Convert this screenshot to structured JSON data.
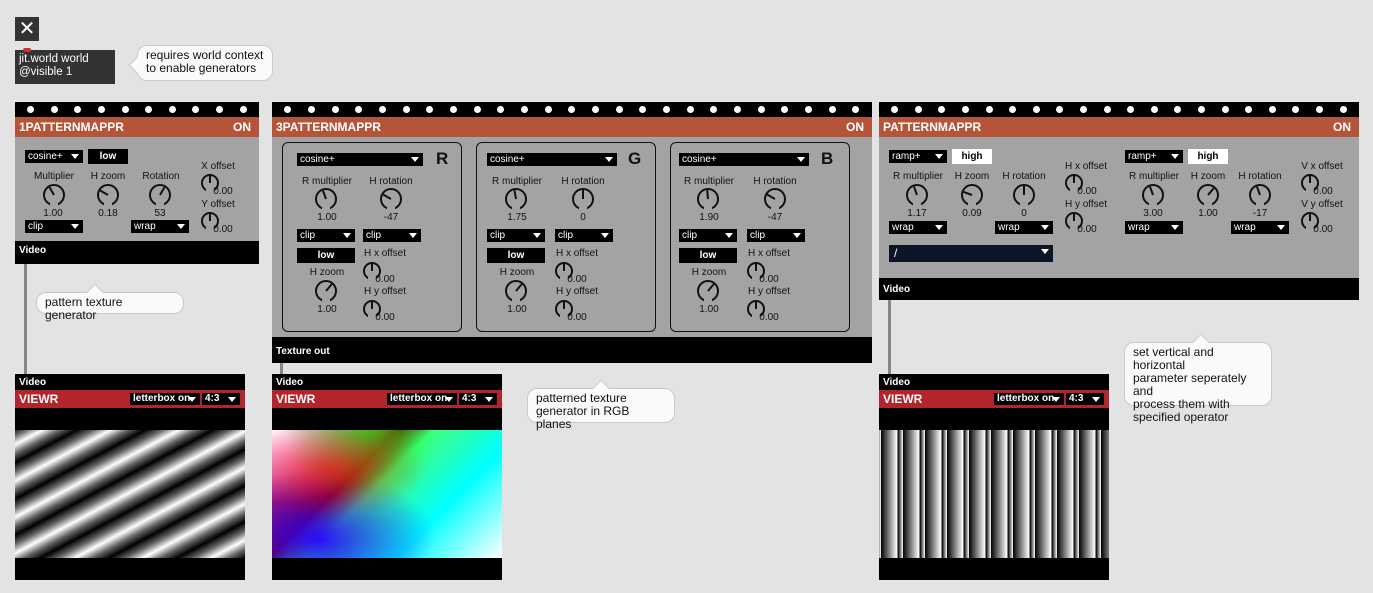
{
  "close_glyph": "✕",
  "world": {
    "line1": "jit.world world",
    "line2": "@visible 1"
  },
  "comments": {
    "world": [
      "requires world context",
      "to enable generators"
    ],
    "pattern": "pattern texture generator",
    "rgb": [
      "patterned texture",
      "generator in RGB planes"
    ],
    "vh": [
      "set vertical and horizontal",
      "parameter seperately and",
      "process them with",
      "specified operator"
    ]
  },
  "d1": {
    "title": "1PATTERNMAPPR",
    "status": "ON",
    "shape": "cosine+",
    "res": "low",
    "labels": {
      "mult": "Multiplier",
      "hzoom": "H zoom",
      "rot": "Rotation",
      "xoff": "X offset",
      "yoff": "Y offset"
    },
    "values": {
      "mult": "1.00",
      "hzoom": "0.18",
      "rot": "53",
      "xoff": "0.00",
      "yoff": "0.00"
    },
    "mode1": "clip",
    "mode2": "wrap",
    "out": "Video"
  },
  "d3": {
    "title": "3PATTERNMAPPR",
    "status": "ON",
    "out": "Texture out",
    "labels": {
      "rmult": "R multiplier",
      "hrot": "H rotation",
      "hx": "H x offset",
      "hzoom": "H zoom",
      "hy": "H y offset"
    },
    "planes": [
      {
        "letter": "R",
        "shape": "cosine+",
        "rmult": "1.00",
        "hrot": "-47",
        "m1": "clip",
        "m2": "clip",
        "res": "low",
        "hx": "0.00",
        "hzoom": "1.00",
        "hy": "0.00"
      },
      {
        "letter": "G",
        "shape": "cosine+",
        "rmult": "1.75",
        "hrot": "0",
        "m1": "clip",
        "m2": "clip",
        "res": "low",
        "hx": "0.00",
        "hzoom": "1.00",
        "hy": "0.00"
      },
      {
        "letter": "B",
        "shape": "cosine+",
        "rmult": "1.90",
        "hrot": "-47",
        "m1": "clip",
        "m2": "clip",
        "res": "low",
        "hx": "0.00",
        "hzoom": "1.00",
        "hy": "0.00"
      }
    ]
  },
  "dp": {
    "title": "PATTERNMAPPR",
    "status": "ON",
    "out": "Video",
    "operator": "/",
    "h": {
      "shape": "ramp+",
      "res": "high",
      "rmult": "1.17",
      "hzoom": "0.09",
      "hrot": "0",
      "hx": "0.00",
      "hy": "0.00",
      "m1": "wrap",
      "m2": "wrap"
    },
    "v": {
      "shape": "ramp+",
      "res": "high",
      "rmult": "3.00",
      "hzoom": "1.00",
      "hrot": "-17",
      "vx": "0.00",
      "vy": "0.00",
      "m1": "wrap",
      "m2": "wrap"
    },
    "labels": {
      "rmult": "R multiplier",
      "hzoom": "H zoom",
      "hrot": "H rotation",
      "hx": "H x offset",
      "hy": "H y offset",
      "vx": "V x offset",
      "vy": "V y offset"
    }
  },
  "viewer": {
    "in": "Video",
    "title": "VIEWR",
    "fit": "letterbox on",
    "aspect": "4:3"
  }
}
